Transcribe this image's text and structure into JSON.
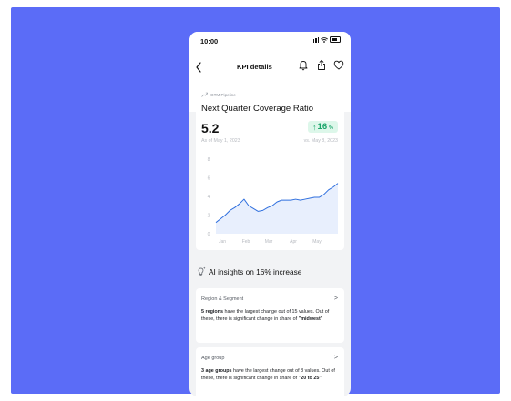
{
  "status": {
    "time": "10:00"
  },
  "nav": {
    "title": "KPI details"
  },
  "kpi": {
    "breadcrumb": "GTM Pipeline",
    "title": "Next Quarter Coverage Ratio",
    "value": "5.2",
    "change": {
      "arrow": "↑",
      "value": "16",
      "unit": "%"
    },
    "as_of": "As of May 1, 2023",
    "vs": "vs. May 8, 2023"
  },
  "chart_data": {
    "type": "area",
    "title": "",
    "xlabel": "",
    "ylabel": "",
    "ylim": [
      0,
      8
    ],
    "yticks": [
      "0",
      "2",
      "4",
      "6",
      "8"
    ],
    "xticks": [
      "Jan",
      "Feb",
      "Mar",
      "Apr",
      "May"
    ],
    "grid": false,
    "series": [
      {
        "values": [
          1.2,
          1.6,
          2.0,
          2.5,
          2.8,
          3.2,
          3.7,
          3.0,
          2.7,
          2.4,
          2.5,
          2.8,
          3.0,
          3.4,
          3.6,
          3.6,
          3.6,
          3.7,
          3.6,
          3.7,
          3.8,
          3.9,
          3.9,
          4.2,
          4.7,
          5.0,
          5.4
        ]
      }
    ],
    "colors": {
      "line": "#2f6fde",
      "fill": "#e8effd"
    }
  },
  "insights": {
    "title": "AI insights on 16% increase",
    "cards": [
      {
        "heading": "Region & Segment",
        "bold": "5 regions",
        "text1": " have the largest change out of 15 values. Out of these, there is significant change in share of ",
        "quote": "\"midwest\"",
        "text2": ""
      },
      {
        "heading": "Age group",
        "bold": "3 age groups",
        "text1": " have the largest change out of 8 values. Out of these, there is significant change in share of ",
        "quote": "\"20 to 25\"",
        "text2": "."
      }
    ]
  },
  "icons": [
    "back-arrow-icon",
    "bell-icon",
    "share-icon",
    "heart-icon",
    "trend-icon",
    "ai-sparkle-icon",
    "chevron-right-icon"
  ],
  "colors": {
    "background": "#5b6cf7",
    "accent": "#2f6fde",
    "positive": "#1aa56a",
    "positive_bg": "#ddf7ea"
  }
}
